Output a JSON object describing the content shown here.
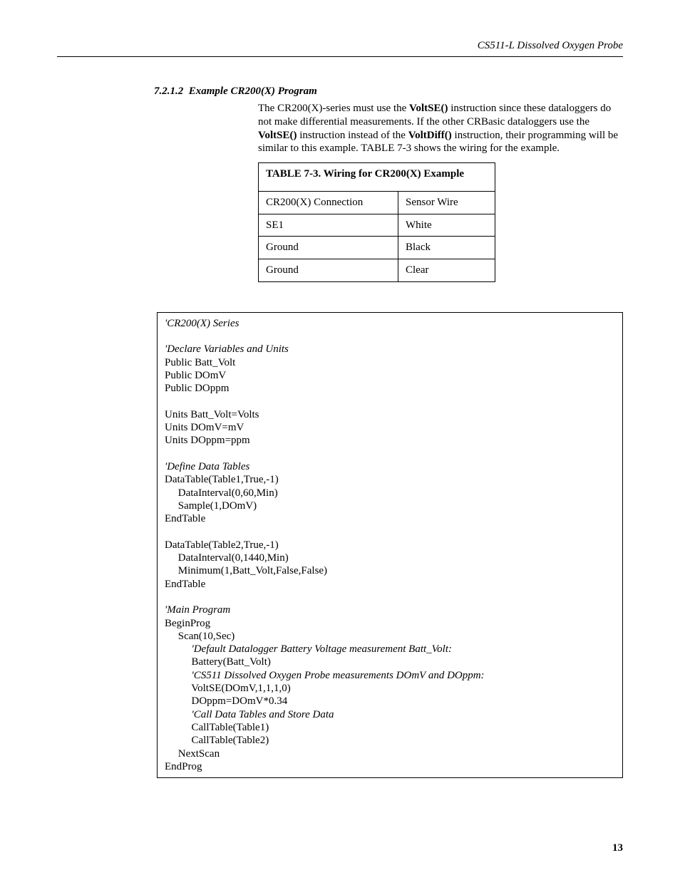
{
  "header": {
    "doc_title": "CS511-L Dissolved Oxygen Probe"
  },
  "section": {
    "number": "7.2.1.2",
    "title": "Example CR200(X) Program"
  },
  "paragraph": {
    "p1_a": "The CR200(X)-series must use the ",
    "p1_b": "VoltSE()",
    "p1_c": " instruction since these dataloggers do not make differential measurements.  If the other CRBasic dataloggers use the ",
    "p1_d": "VoltSE()",
    "p1_e": " instruction instead of the ",
    "p1_f": "VoltDiff()",
    "p1_g": " instruction, their programming will be similar to this example.  TABLE 7-3 shows the wiring for the example."
  },
  "table": {
    "title": "TABLE 7-3.  Wiring for CR200(X) Example",
    "col1": "CR200(X) Connection",
    "col2": "Sensor Wire",
    "rows": [
      {
        "c1": "SE1",
        "c2": "White"
      },
      {
        "c1": "Ground",
        "c2": "Black"
      },
      {
        "c1": "Ground",
        "c2": "Clear"
      }
    ]
  },
  "code": {
    "l01": "'CR200(X) Series",
    "l02": "'Declare Variables and Units",
    "l03": "Public Batt_Volt",
    "l04": "Public DOmV",
    "l05": "Public DOppm",
    "l06": "Units Batt_Volt=Volts",
    "l07": "Units DOmV=mV",
    "l08": "Units DOppm=ppm",
    "l09": "'Define Data Tables",
    "l10": "DataTable(Table1,True,-1)",
    "l11": "     DataInterval(0,60,Min)",
    "l12": "     Sample(1,DOmV)",
    "l13": "EndTable",
    "l14": "DataTable(Table2,True,-1)",
    "l15": "     DataInterval(0,1440,Min)",
    "l16": "     Minimum(1,Batt_Volt,False,False)",
    "l17": "EndTable",
    "l18": "'Main Program",
    "l19": "BeginProg",
    "l20": "     Scan(10,Sec)",
    "l21": "          'Default Datalogger Battery Voltage measurement Batt_Volt:",
    "l22": "          Battery(Batt_Volt)",
    "l23": "          'CS511 Dissolved Oxygen Probe measurements DOmV and DOppm:",
    "l24": "          VoltSE(DOmV,1,1,1,0)",
    "l25": "          DOppm=DOmV*0.34",
    "l26": "          'Call Data Tables and Store Data",
    "l27": "          CallTable(Table1)",
    "l28": "          CallTable(Table2)",
    "l29": "     NextScan",
    "l30": "EndProg"
  },
  "page_number": "13"
}
